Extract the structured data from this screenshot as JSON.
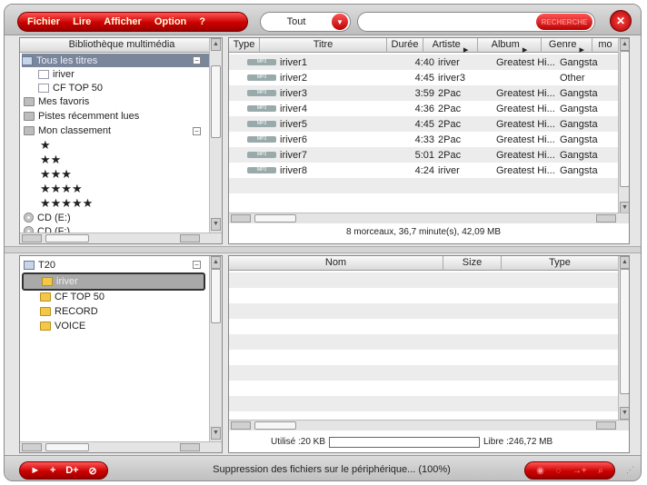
{
  "menu": {
    "items": [
      "Fichier",
      "Lire",
      "Afficher",
      "Option",
      "?"
    ]
  },
  "filter": {
    "selected": "Tout"
  },
  "search": {
    "value": "",
    "button_label": "RECHERCHE"
  },
  "library": {
    "header": "Bibliothèque multimédia",
    "root_label": "Tous les titres",
    "root_items": [
      "iriver",
      "CF TOP 50"
    ],
    "favorites_label": "Mes favoris",
    "recent_label": "Pistes récemment lues",
    "ranking_label": "Mon classement",
    "ranking_stars": [
      "★",
      "★★",
      "★★★",
      "★★★★",
      "★★★★★"
    ],
    "drives": [
      "CD (E:)",
      "CD (F:)"
    ]
  },
  "tracks": {
    "columns": [
      "Type",
      "Titre",
      "Durée",
      "Artiste",
      "Album",
      "Genre",
      "mo"
    ],
    "type_badge": "MP3",
    "rows": [
      {
        "title": "iriver1",
        "duration": "4:40",
        "artist": "iriver",
        "album": "Greatest Hi...",
        "genre": "Gangsta"
      },
      {
        "title": "iriver2",
        "duration": "4:45",
        "artist": "iriver3",
        "album": "",
        "genre": "Other"
      },
      {
        "title": "iriver3",
        "duration": "3:59",
        "artist": "2Pac",
        "album": "Greatest Hi...",
        "genre": "Gangsta"
      },
      {
        "title": "iriver4",
        "duration": "4:36",
        "artist": "2Pac",
        "album": "Greatest Hi...",
        "genre": "Gangsta"
      },
      {
        "title": "iriver5",
        "duration": "4:45",
        "artist": "2Pac",
        "album": "Greatest Hi...",
        "genre": "Gangsta"
      },
      {
        "title": "iriver6",
        "duration": "4:33",
        "artist": "2Pac",
        "album": "Greatest Hi...",
        "genre": "Gangsta"
      },
      {
        "title": "iriver7",
        "duration": "5:01",
        "artist": "2Pac",
        "album": "Greatest Hi...",
        "genre": "Gangsta"
      },
      {
        "title": "iriver8",
        "duration": "4:24",
        "artist": "iriver",
        "album": "Greatest Hi...",
        "genre": "Gangsta"
      }
    ],
    "summary": "8 morceaux, 36,7 minute(s), 42,09 MB"
  },
  "device": {
    "root_label": "T20",
    "folders": [
      "iriver",
      "CF TOP 50",
      "RECORD",
      "VOICE"
    ],
    "selected_folder_index": 0
  },
  "device_files": {
    "columns": [
      "Nom",
      "Size",
      "Type"
    ],
    "used_label": "Utilisé :20 KB",
    "free_label": "Libre :246,72 MB",
    "used_fraction": 0.0
  },
  "bottom": {
    "left_controls": [
      "►",
      "+",
      "D+",
      "⊘"
    ],
    "message": "Suppression des fichiers sur le périphérique... (100%)",
    "right_controls": [
      "◉",
      "◌",
      "→+",
      "⌕"
    ]
  }
}
